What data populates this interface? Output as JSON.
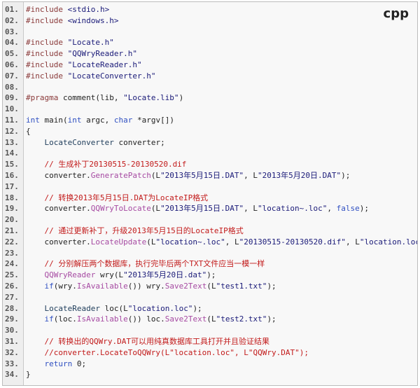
{
  "language_badge": "cpp",
  "lines": [
    {
      "num": "01.",
      "tokens": [
        {
          "t": "#include",
          "c": "pp"
        },
        {
          "t": " <stdio.h>",
          "c": "str"
        }
      ]
    },
    {
      "num": "02.",
      "tokens": [
        {
          "t": "#include",
          "c": "pp"
        },
        {
          "t": " <windows.h>",
          "c": "str"
        }
      ]
    },
    {
      "num": "03.",
      "tokens": []
    },
    {
      "num": "04.",
      "tokens": [
        {
          "t": "#include",
          "c": "pp"
        },
        {
          "t": " \"Locate.h\"",
          "c": "str"
        }
      ]
    },
    {
      "num": "05.",
      "tokens": [
        {
          "t": "#include",
          "c": "pp"
        },
        {
          "t": " \"QQWryReader.h\"",
          "c": "str"
        }
      ]
    },
    {
      "num": "06.",
      "tokens": [
        {
          "t": "#include",
          "c": "pp"
        },
        {
          "t": " \"LocateReader.h\"",
          "c": "str"
        }
      ]
    },
    {
      "num": "07.",
      "tokens": [
        {
          "t": "#include",
          "c": "pp"
        },
        {
          "t": " \"LocateConverter.h\"",
          "c": "str"
        }
      ]
    },
    {
      "num": "08.",
      "tokens": []
    },
    {
      "num": "09.",
      "tokens": [
        {
          "t": "#pragma",
          "c": "pp"
        },
        {
          "t": " comment(lib, ",
          "c": "p"
        },
        {
          "t": "\"Locate.lib\"",
          "c": "str"
        },
        {
          "t": ")",
          "c": "p"
        }
      ]
    },
    {
      "num": "10.",
      "tokens": []
    },
    {
      "num": "11.",
      "tokens": [
        {
          "t": "int",
          "c": "kw"
        },
        {
          "t": " main(",
          "c": "p"
        },
        {
          "t": "int",
          "c": "kw"
        },
        {
          "t": " argc, ",
          "c": "p"
        },
        {
          "t": "char",
          "c": "kw"
        },
        {
          "t": " *argv[])",
          "c": "p"
        }
      ]
    },
    {
      "num": "12.",
      "tokens": [
        {
          "t": "{",
          "c": "p"
        }
      ]
    },
    {
      "num": "13.",
      "tokens": [
        {
          "t": "    LocateConverter",
          "c": "id"
        },
        {
          "t": " converter;",
          "c": "p"
        }
      ]
    },
    {
      "num": "14.",
      "tokens": []
    },
    {
      "num": "15.",
      "tokens": [
        {
          "t": "    // 生成补丁20130515-20130520.dif",
          "c": "cm"
        }
      ]
    },
    {
      "num": "16.",
      "tokens": [
        {
          "t": "    converter.",
          "c": "p"
        },
        {
          "t": "GeneratePatch",
          "c": "fn"
        },
        {
          "t": "(L",
          "c": "p"
        },
        {
          "t": "\"2013年5月15日.DAT\"",
          "c": "str"
        },
        {
          "t": ", L",
          "c": "p"
        },
        {
          "t": "\"2013年5月20日.DAT\"",
          "c": "str"
        },
        {
          "t": ");",
          "c": "p"
        }
      ]
    },
    {
      "num": "17.",
      "tokens": []
    },
    {
      "num": "18.",
      "tokens": [
        {
          "t": "    // 转换2013年5月15日.DAT为LocateIP格式",
          "c": "cm"
        }
      ]
    },
    {
      "num": "19.",
      "tokens": [
        {
          "t": "    converter.",
          "c": "p"
        },
        {
          "t": "QQWryToLocate",
          "c": "fn"
        },
        {
          "t": "(L",
          "c": "p"
        },
        {
          "t": "\"2013年5月15日.DAT\"",
          "c": "str"
        },
        {
          "t": ", L",
          "c": "p"
        },
        {
          "t": "\"location~.loc\"",
          "c": "str"
        },
        {
          "t": ", ",
          "c": "p"
        },
        {
          "t": "false",
          "c": "kw"
        },
        {
          "t": ");",
          "c": "p"
        }
      ]
    },
    {
      "num": "20.",
      "tokens": []
    },
    {
      "num": "21.",
      "tokens": [
        {
          "t": "    // 通过更新补丁，升级2013年5月15日的LocateIP格式",
          "c": "cm"
        }
      ]
    },
    {
      "num": "22.",
      "tokens": [
        {
          "t": "    converter.",
          "c": "p"
        },
        {
          "t": "LocateUpdate",
          "c": "fn"
        },
        {
          "t": "(L",
          "c": "p"
        },
        {
          "t": "\"location~.loc\"",
          "c": "str"
        },
        {
          "t": ", L",
          "c": "p"
        },
        {
          "t": "\"20130515-20130520.dif\"",
          "c": "str"
        },
        {
          "t": ", L",
          "c": "p"
        },
        {
          "t": "\"location.loc\"",
          "c": "str"
        },
        {
          "t": ", ",
          "c": "p"
        },
        {
          "t": "fal",
          "c": "kw"
        }
      ]
    },
    {
      "num": "23.",
      "tokens": []
    },
    {
      "num": "24.",
      "tokens": [
        {
          "t": "    // 分别解压两个数据库，执行完毕后两个TXT文件应当一模一样",
          "c": "cm"
        }
      ]
    },
    {
      "num": "25.",
      "tokens": [
        {
          "t": "    QQWryReader",
          "c": "fn"
        },
        {
          "t": " wry(L",
          "c": "p"
        },
        {
          "t": "\"2013年5月20日.dat\"",
          "c": "str"
        },
        {
          "t": ");",
          "c": "p"
        }
      ]
    },
    {
      "num": "26.",
      "tokens": [
        {
          "t": "    if",
          "c": "kw"
        },
        {
          "t": "(wry.",
          "c": "p"
        },
        {
          "t": "IsAvailable",
          "c": "fn"
        },
        {
          "t": "()) wry.",
          "c": "p"
        },
        {
          "t": "Save2Text",
          "c": "fn"
        },
        {
          "t": "(L",
          "c": "p"
        },
        {
          "t": "\"test1.txt\"",
          "c": "str"
        },
        {
          "t": ");",
          "c": "p"
        }
      ]
    },
    {
      "num": "27.",
      "tokens": []
    },
    {
      "num": "28.",
      "tokens": [
        {
          "t": "    LocateReader",
          "c": "id"
        },
        {
          "t": " loc(L",
          "c": "p"
        },
        {
          "t": "\"location.loc\"",
          "c": "str"
        },
        {
          "t": ");",
          "c": "p"
        }
      ]
    },
    {
      "num": "29.",
      "tokens": [
        {
          "t": "    if",
          "c": "kw"
        },
        {
          "t": "(loc.",
          "c": "p"
        },
        {
          "t": "IsAvailable",
          "c": "fn"
        },
        {
          "t": "()) loc.",
          "c": "p"
        },
        {
          "t": "Save2Text",
          "c": "fn"
        },
        {
          "t": "(L",
          "c": "p"
        },
        {
          "t": "\"test2.txt\"",
          "c": "str"
        },
        {
          "t": ");",
          "c": "p"
        }
      ]
    },
    {
      "num": "30.",
      "tokens": []
    },
    {
      "num": "31.",
      "tokens": [
        {
          "t": "    // 转换出的QQWry.DAT可以用纯真数据库工具打开并且验证结果",
          "c": "cm"
        }
      ]
    },
    {
      "num": "32.",
      "tokens": [
        {
          "t": "    //converter.LocateToQQWry(L\"location.loc\", L\"QQWry.DAT\");",
          "c": "cm"
        }
      ]
    },
    {
      "num": "33.",
      "tokens": [
        {
          "t": "    return",
          "c": "kw"
        },
        {
          "t": " 0;",
          "c": "p"
        }
      ]
    },
    {
      "num": "34.",
      "tokens": [
        {
          "t": "}",
          "c": "p"
        }
      ]
    }
  ]
}
